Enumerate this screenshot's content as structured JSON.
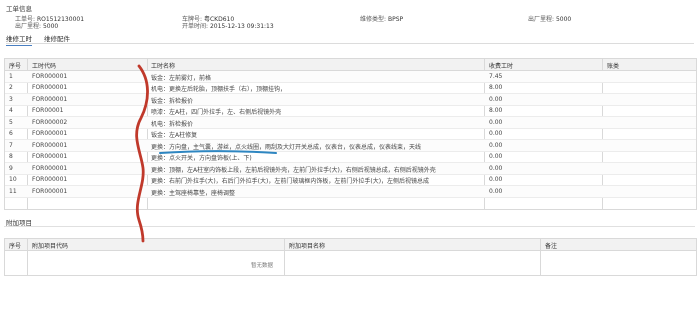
{
  "header": {
    "section_title": "工单信息",
    "fields": [
      {
        "label": "工单号:",
        "value": "RO1512130001"
      },
      {
        "label": "车牌号:",
        "value": "粤CKD610"
      },
      {
        "label": "维修类型:",
        "value": "BPSP"
      },
      {
        "label": "出厂里程:",
        "value": "5000"
      },
      {
        "label": "出厂里程:",
        "value": "5000"
      },
      {
        "label": "开单时间:",
        "value": "2015-12-13 09:31:13"
      }
    ]
  },
  "tabs": [
    {
      "label": "维修工时"
    },
    {
      "label": "维修配件"
    }
  ],
  "labor_table": {
    "columns": [
      "序号",
      "工时代码",
      "工时名称",
      "收费工时",
      "账类"
    ],
    "rows": [
      {
        "no": "1",
        "code": "FOR000001",
        "name": "钣金：左前雾灯，前格",
        "hours": "7.45",
        "acct": ""
      },
      {
        "no": "2",
        "code": "FOR000001",
        "name": "机电：更换左后轮胎，顶棚扶手（右），顶棚挂钩，",
        "hours": "8.00",
        "acct": ""
      },
      {
        "no": "3",
        "code": "FOR000001",
        "name": "钣金：拆检报价",
        "hours": "0.00",
        "acct": ""
      },
      {
        "no": "4",
        "code": "FOR00001",
        "name": "喷漆：左A柱，四门外拉手，左、右侧后视镜外壳",
        "hours": "8.00",
        "acct": ""
      },
      {
        "no": "5",
        "code": "FOR000002",
        "name": "机电：拆检报价",
        "hours": "0.00",
        "acct": ""
      },
      {
        "no": "6",
        "code": "FOR000001",
        "name": "钣金：左A柱修复",
        "hours": "0.00",
        "acct": ""
      },
      {
        "no": "7",
        "code": "FOR000001",
        "name": "更换：方向盘，主气囊，游丝，点火线圈，雨刮及大灯开关总成，仪表台，仪表总成，仪表线束，天线",
        "hours": "0.00",
        "acct": ""
      },
      {
        "no": "8",
        "code": "FOR000001",
        "name": "更换：点火开关，方向盘饰板(上、下)",
        "hours": "0.00",
        "acct": ""
      },
      {
        "no": "9",
        "code": "FOR000001",
        "name": "更换：顶棚，左A柱室内饰板上段，左前后视镜外壳，左前门外拉手(大)，右侧后视镜总成，右侧后视镜外壳",
        "hours": "0.00",
        "acct": ""
      },
      {
        "no": "10",
        "code": "FOR000001",
        "name": "更换：右前门外拉手(大)，右后门外拉手(大)，左前门玻璃框内饰板，左前门外拉手(大)，左侧后视镜总成",
        "hours": "0.00",
        "acct": ""
      },
      {
        "no": "11",
        "code": "FOR000001",
        "name": "更换：主驾座椅靠垫，座椅调整",
        "hours": "0.00",
        "acct": ""
      }
    ]
  },
  "extras": {
    "title": "附加项目",
    "columns": [
      "序号",
      "附加项目代码",
      "附加项目名称",
      "备注"
    ],
    "empty_text": "暂无数据"
  },
  "annotation_colors": {
    "red_mark": "#c0392b",
    "blue_mark": "#2e86c1"
  }
}
